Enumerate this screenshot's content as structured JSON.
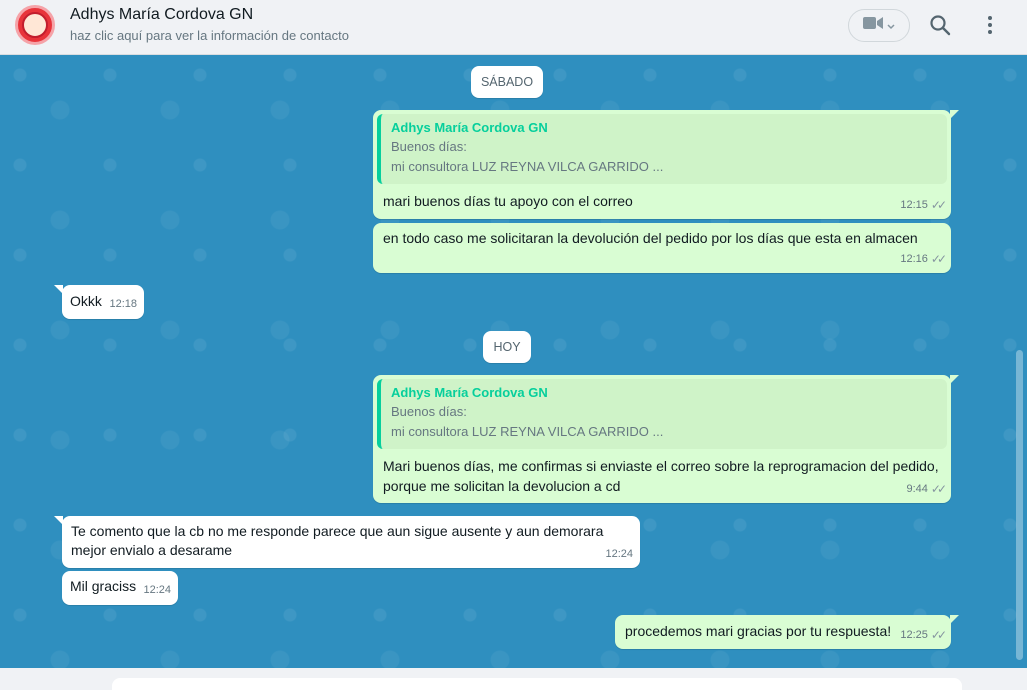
{
  "header": {
    "contact_name": "Adhys María Cordova GN",
    "contact_subtitle": "haz clic aquí para ver la información de contacto"
  },
  "icons": {
    "video": "video-camera-icon",
    "search": "search-icon",
    "menu": "kebab-menu-icon"
  },
  "chat": {
    "date_sabado": "SÁBADO",
    "date_hoy": "HOY",
    "messages": [
      {
        "direction": "out",
        "quote": {
          "author": "Adhys María Cordova GN",
          "line1": "Buenos días:",
          "line2": "mi consultora LUZ REYNA VILCA GARRIDO    ..."
        },
        "text": "mari buenos días tu apoyo con el correo",
        "time": "12:15"
      },
      {
        "direction": "out",
        "text": "en todo caso me solicitaran la devolución del pedido por los días que esta en almacen",
        "time": "12:16"
      },
      {
        "direction": "in",
        "text": "Okkk",
        "time": "12:18"
      },
      {
        "direction": "out",
        "quote": {
          "author": "Adhys María Cordova GN",
          "line1": "Buenos días:",
          "line2": "mi consultora LUZ REYNA VILCA GARRIDO    ..."
        },
        "text_line1": "Mari buenos días, me confirmas si enviaste el correo sobre la reprogramacion del pedido,",
        "text_line2": "porque me solicitan la devolucion a cd",
        "time": "9:44"
      },
      {
        "direction": "in",
        "text_line1": "Te comento que la cb no me responde parece que aun sigue ausente y aun demorara",
        "text_line2": "mejor envialo a desarame",
        "time": "12:24"
      },
      {
        "direction": "in",
        "text": "Mil graciss",
        "time": "12:24"
      },
      {
        "direction": "out",
        "text": "procedemos mari gracias por tu respuesta!",
        "time": "12:25"
      }
    ]
  },
  "colors": {
    "outgoing_bubble": "#d9fdd3",
    "incoming_bubble": "#ffffff",
    "chat_background": "#2f8fbf",
    "quote_author": "#06cf9c"
  }
}
